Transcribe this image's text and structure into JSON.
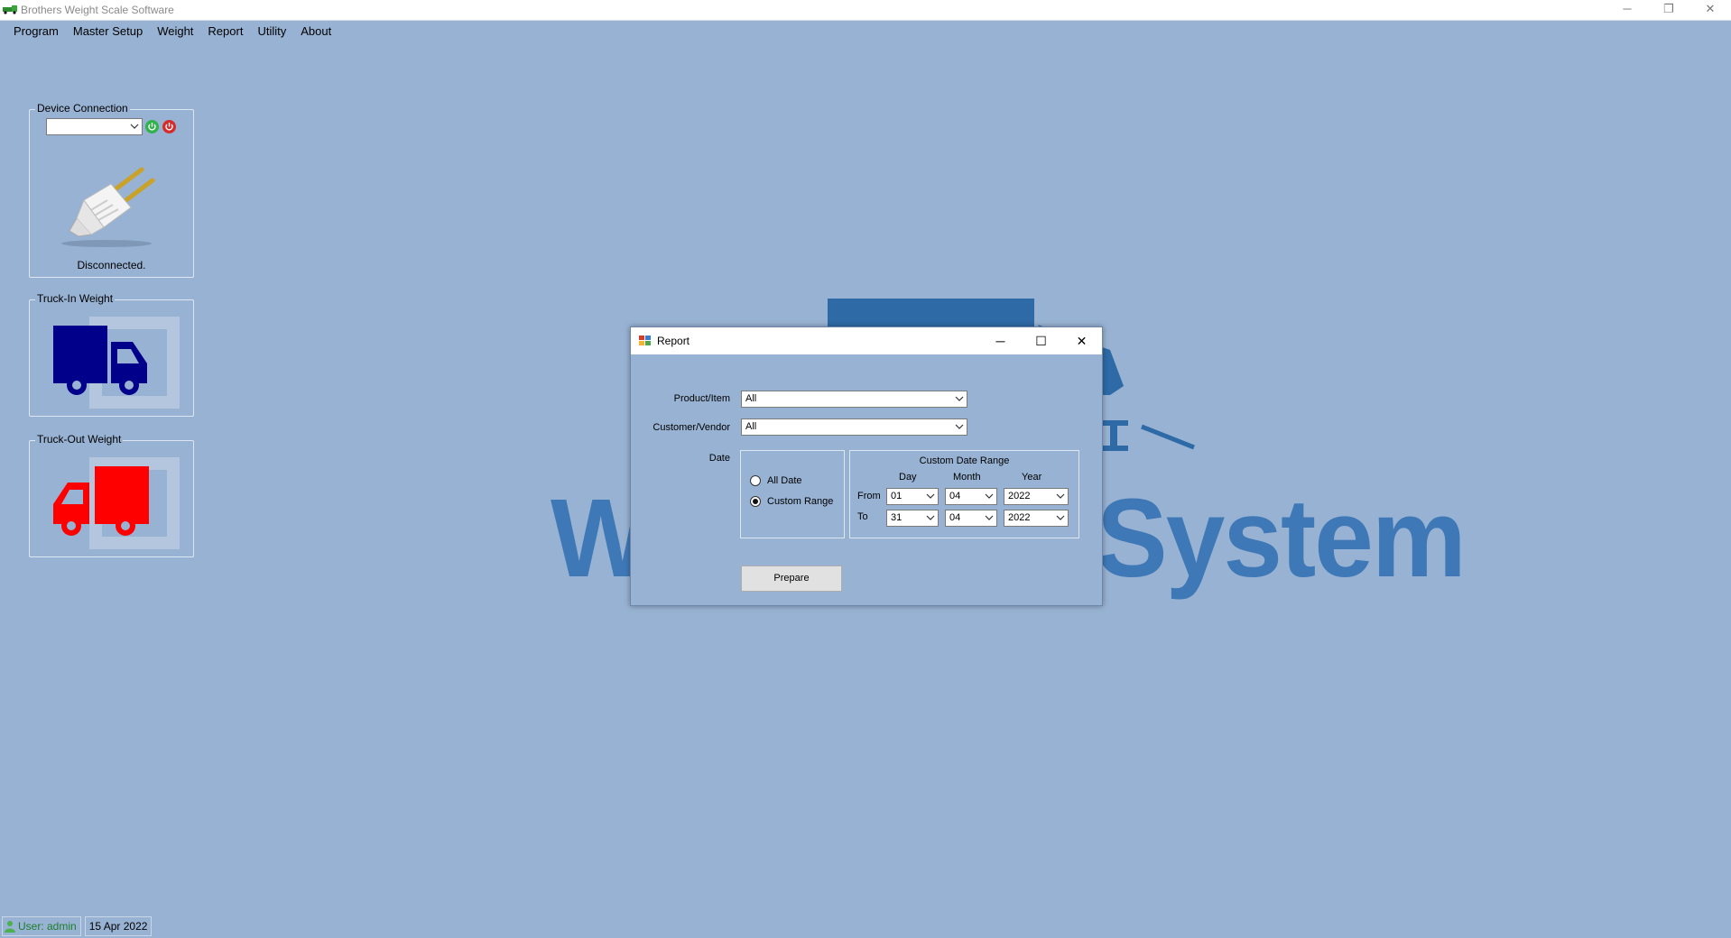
{
  "window": {
    "title": "Brothers Weight Scale Software",
    "controls": {
      "minimize": "─",
      "restore": "❐",
      "close": "✕"
    }
  },
  "menu": [
    "Program",
    "Master Setup",
    "Weight",
    "Report",
    "Utility",
    "About"
  ],
  "panels": {
    "device_connection": {
      "legend": "Device Connection",
      "port_value": "",
      "status": "Disconnected."
    },
    "truck_in": {
      "legend": "Truck-In Weight",
      "color": "#00008b"
    },
    "truck_out": {
      "legend": "Truck-Out Weight",
      "color": "#ff0000"
    }
  },
  "background_logo": {
    "text_left": "W",
    "text_right": "System",
    "color": "#3f78b6"
  },
  "report_dialog": {
    "title": "Report",
    "controls": {
      "minimize": "─",
      "maximize": "☐",
      "close": "✕"
    },
    "product_label": "Product/Item",
    "product_value": "All",
    "customer_label": "Customer/Vendor",
    "customer_value": "All",
    "date_label": "Date",
    "date_options": [
      {
        "label": "All Date",
        "checked": false
      },
      {
        "label": "Custom Range",
        "checked": true
      }
    ],
    "custom_range": {
      "title": "Custom Date Range",
      "headers": {
        "day": "Day",
        "month": "Month",
        "year": "Year"
      },
      "from": {
        "label": "From",
        "day": "01",
        "month": "04",
        "year": "2022"
      },
      "to": {
        "label": "To",
        "day": "31",
        "month": "04",
        "year": "2022"
      }
    },
    "prepare_label": "Prepare"
  },
  "status": {
    "user": "User: admin",
    "date": "15 Apr 2022"
  }
}
